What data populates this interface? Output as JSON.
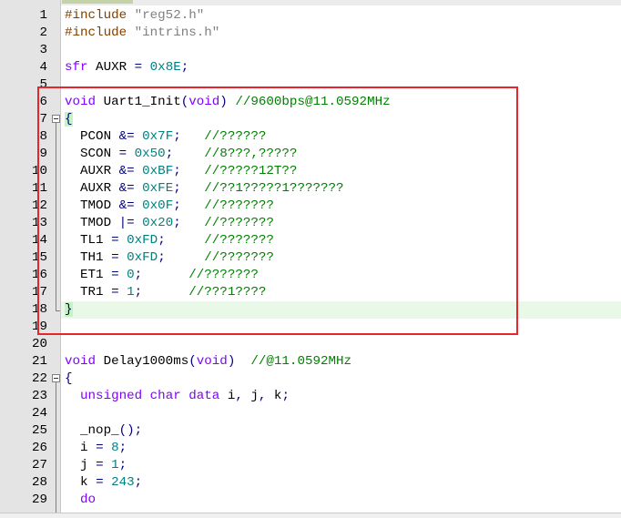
{
  "editor": {
    "highlight_color": "#e8242c",
    "caret_line_color": "#e8f9e8",
    "lines": [
      {
        "n": "1",
        "fold": false,
        "tokens": [
          {
            "t": "#include ",
            "c": "pre"
          },
          {
            "t": "\"reg52.h\"",
            "c": "str"
          }
        ]
      },
      {
        "n": "2",
        "fold": false,
        "tokens": [
          {
            "t": "#include ",
            "c": "pre"
          },
          {
            "t": "\"intrins.h\"",
            "c": "str"
          }
        ]
      },
      {
        "n": "3",
        "fold": false,
        "tokens": []
      },
      {
        "n": "4",
        "fold": false,
        "tokens": [
          {
            "t": "sfr",
            "c": "kw"
          },
          {
            "t": " AUXR ",
            "c": "plain"
          },
          {
            "t": "=",
            "c": "op"
          },
          {
            "t": " ",
            "c": "plain"
          },
          {
            "t": "0x8E",
            "c": "num"
          },
          {
            "t": ";",
            "c": "op"
          }
        ]
      },
      {
        "n": "5",
        "fold": false,
        "tokens": []
      },
      {
        "n": "6",
        "fold": false,
        "tokens": [
          {
            "t": "void",
            "c": "kw"
          },
          {
            "t": " Uart1_Init",
            "c": "plain"
          },
          {
            "t": "(",
            "c": "op"
          },
          {
            "t": "void",
            "c": "kw"
          },
          {
            "t": ")",
            "c": "op"
          },
          {
            "t": " ",
            "c": "plain"
          },
          {
            "t": "//9600bps@11.0592MHz",
            "c": "cmt"
          }
        ]
      },
      {
        "n": "7",
        "fold": true,
        "tokens": [
          {
            "t": "{",
            "c": "brace"
          }
        ]
      },
      {
        "n": "8",
        "fold": false,
        "tokens": [
          {
            "t": "  PCON ",
            "c": "plain"
          },
          {
            "t": "&=",
            "c": "op"
          },
          {
            "t": " ",
            "c": "plain"
          },
          {
            "t": "0x7F",
            "c": "num"
          },
          {
            "t": ";",
            "c": "op"
          },
          {
            "t": "   ",
            "c": "plain"
          },
          {
            "t": "//??????",
            "c": "cmt"
          }
        ]
      },
      {
        "n": "9",
        "fold": false,
        "tokens": [
          {
            "t": "  SCON ",
            "c": "plain"
          },
          {
            "t": "=",
            "c": "op"
          },
          {
            "t": " ",
            "c": "plain"
          },
          {
            "t": "0x50",
            "c": "num"
          },
          {
            "t": ";",
            "c": "op"
          },
          {
            "t": "    ",
            "c": "plain"
          },
          {
            "t": "//8???,?????",
            "c": "cmt"
          }
        ]
      },
      {
        "n": "10",
        "fold": false,
        "tokens": [
          {
            "t": "  AUXR ",
            "c": "plain"
          },
          {
            "t": "&=",
            "c": "op"
          },
          {
            "t": " ",
            "c": "plain"
          },
          {
            "t": "0xBF",
            "c": "num"
          },
          {
            "t": ";",
            "c": "op"
          },
          {
            "t": "   ",
            "c": "plain"
          },
          {
            "t": "//?????12T??",
            "c": "cmt"
          }
        ]
      },
      {
        "n": "11",
        "fold": false,
        "tokens": [
          {
            "t": "  AUXR ",
            "c": "plain"
          },
          {
            "t": "&=",
            "c": "op"
          },
          {
            "t": " ",
            "c": "plain"
          },
          {
            "t": "0xFE",
            "c": "num"
          },
          {
            "t": ";",
            "c": "op"
          },
          {
            "t": "   ",
            "c": "plain"
          },
          {
            "t": "//??1?????1???????",
            "c": "cmt"
          }
        ]
      },
      {
        "n": "12",
        "fold": false,
        "tokens": [
          {
            "t": "  TMOD ",
            "c": "plain"
          },
          {
            "t": "&=",
            "c": "op"
          },
          {
            "t": " ",
            "c": "plain"
          },
          {
            "t": "0x0F",
            "c": "num"
          },
          {
            "t": ";",
            "c": "op"
          },
          {
            "t": "   ",
            "c": "plain"
          },
          {
            "t": "//???????",
            "c": "cmt"
          }
        ]
      },
      {
        "n": "13",
        "fold": false,
        "tokens": [
          {
            "t": "  TMOD ",
            "c": "plain"
          },
          {
            "t": "|=",
            "c": "op"
          },
          {
            "t": " ",
            "c": "plain"
          },
          {
            "t": "0x20",
            "c": "num"
          },
          {
            "t": ";",
            "c": "op"
          },
          {
            "t": "   ",
            "c": "plain"
          },
          {
            "t": "//???????",
            "c": "cmt"
          }
        ]
      },
      {
        "n": "14",
        "fold": false,
        "tokens": [
          {
            "t": "  TL1 ",
            "c": "plain"
          },
          {
            "t": "=",
            "c": "op"
          },
          {
            "t": " ",
            "c": "plain"
          },
          {
            "t": "0xFD",
            "c": "num"
          },
          {
            "t": ";",
            "c": "op"
          },
          {
            "t": "     ",
            "c": "plain"
          },
          {
            "t": "//???????",
            "c": "cmt"
          }
        ]
      },
      {
        "n": "15",
        "fold": false,
        "tokens": [
          {
            "t": "  TH1 ",
            "c": "plain"
          },
          {
            "t": "=",
            "c": "op"
          },
          {
            "t": " ",
            "c": "plain"
          },
          {
            "t": "0xFD",
            "c": "num"
          },
          {
            "t": ";",
            "c": "op"
          },
          {
            "t": "     ",
            "c": "plain"
          },
          {
            "t": "//???????",
            "c": "cmt"
          }
        ]
      },
      {
        "n": "16",
        "fold": false,
        "tokens": [
          {
            "t": "  ET1 ",
            "c": "plain"
          },
          {
            "t": "=",
            "c": "op"
          },
          {
            "t": " ",
            "c": "plain"
          },
          {
            "t": "0",
            "c": "num"
          },
          {
            "t": ";",
            "c": "op"
          },
          {
            "t": "      ",
            "c": "plain"
          },
          {
            "t": "//???????",
            "c": "cmt"
          }
        ]
      },
      {
        "n": "17",
        "fold": false,
        "tokens": [
          {
            "t": "  TR1 ",
            "c": "plain"
          },
          {
            "t": "=",
            "c": "op"
          },
          {
            "t": " ",
            "c": "plain"
          },
          {
            "t": "1",
            "c": "num"
          },
          {
            "t": ";",
            "c": "op"
          },
          {
            "t": "      ",
            "c": "plain"
          },
          {
            "t": "//???1????",
            "c": "cmt"
          }
        ]
      },
      {
        "n": "18",
        "fold": false,
        "tokens": [
          {
            "t": "}",
            "c": "brace"
          }
        ]
      },
      {
        "n": "19",
        "fold": false,
        "tokens": []
      },
      {
        "n": "20",
        "fold": false,
        "tokens": []
      },
      {
        "n": "21",
        "fold": false,
        "tokens": [
          {
            "t": "void",
            "c": "kw"
          },
          {
            "t": " Delay1000ms",
            "c": "plain"
          },
          {
            "t": "(",
            "c": "op"
          },
          {
            "t": "void",
            "c": "kw"
          },
          {
            "t": ")",
            "c": "op"
          },
          {
            "t": "  ",
            "c": "plain"
          },
          {
            "t": "//@11.0592MHz",
            "c": "cmt"
          }
        ]
      },
      {
        "n": "22",
        "fold": true,
        "tokens": [
          {
            "t": "{",
            "c": "op"
          }
        ]
      },
      {
        "n": "23",
        "fold": false,
        "tokens": [
          {
            "t": "  ",
            "c": "plain"
          },
          {
            "t": "unsigned",
            "c": "kw"
          },
          {
            "t": " ",
            "c": "plain"
          },
          {
            "t": "char",
            "c": "kw"
          },
          {
            "t": " ",
            "c": "plain"
          },
          {
            "t": "data",
            "c": "kw"
          },
          {
            "t": " i",
            "c": "plain"
          },
          {
            "t": ",",
            "c": "op"
          },
          {
            "t": " j",
            "c": "plain"
          },
          {
            "t": ",",
            "c": "op"
          },
          {
            "t": " k",
            "c": "plain"
          },
          {
            "t": ";",
            "c": "op"
          }
        ]
      },
      {
        "n": "24",
        "fold": false,
        "tokens": []
      },
      {
        "n": "25",
        "fold": false,
        "tokens": [
          {
            "t": "  _nop_",
            "c": "plain"
          },
          {
            "t": "();",
            "c": "op"
          }
        ]
      },
      {
        "n": "26",
        "fold": false,
        "tokens": [
          {
            "t": "  i ",
            "c": "plain"
          },
          {
            "t": "=",
            "c": "op"
          },
          {
            "t": " ",
            "c": "plain"
          },
          {
            "t": "8",
            "c": "num"
          },
          {
            "t": ";",
            "c": "op"
          }
        ]
      },
      {
        "n": "27",
        "fold": false,
        "tokens": [
          {
            "t": "  j ",
            "c": "plain"
          },
          {
            "t": "=",
            "c": "op"
          },
          {
            "t": " ",
            "c": "plain"
          },
          {
            "t": "1",
            "c": "num"
          },
          {
            "t": ";",
            "c": "op"
          }
        ]
      },
      {
        "n": "28",
        "fold": false,
        "tokens": [
          {
            "t": "  k ",
            "c": "plain"
          },
          {
            "t": "=",
            "c": "op"
          },
          {
            "t": " ",
            "c": "plain"
          },
          {
            "t": "243",
            "c": "num"
          },
          {
            "t": ";",
            "c": "op"
          }
        ]
      },
      {
        "n": "29",
        "fold": false,
        "tokens": [
          {
            "t": "  ",
            "c": "plain"
          },
          {
            "t": "do",
            "c": "kw"
          }
        ]
      }
    ]
  }
}
